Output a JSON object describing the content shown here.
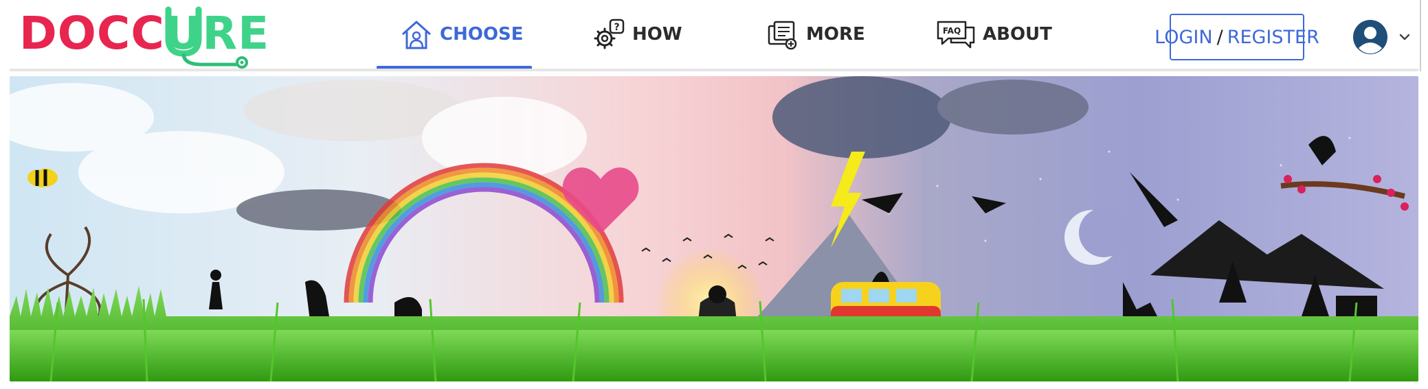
{
  "brand": {
    "part1": "DOCC",
    "part2": "U",
    "part3": "RE"
  },
  "nav": {
    "tabs": [
      {
        "label": "CHOOSE",
        "icon": "home-user-icon",
        "active": true
      },
      {
        "label": "HOW",
        "icon": "gear-question-icon",
        "active": false
      },
      {
        "label": "MORE",
        "icon": "documents-add-icon",
        "active": false
      },
      {
        "label": "ABOUT",
        "icon": "faq-chat-icon",
        "active": false
      }
    ]
  },
  "auth": {
    "login": "LOGIN",
    "separator": "/",
    "register": "REGISTER"
  },
  "user_menu": {
    "icon": "user-avatar-icon",
    "dropdown_icon": "chevron-down-icon"
  },
  "colors": {
    "brand_red": "#e8254f",
    "brand_green": "#3fd38a",
    "accent_blue": "#3d68d8",
    "grass": "#3fae1c"
  }
}
